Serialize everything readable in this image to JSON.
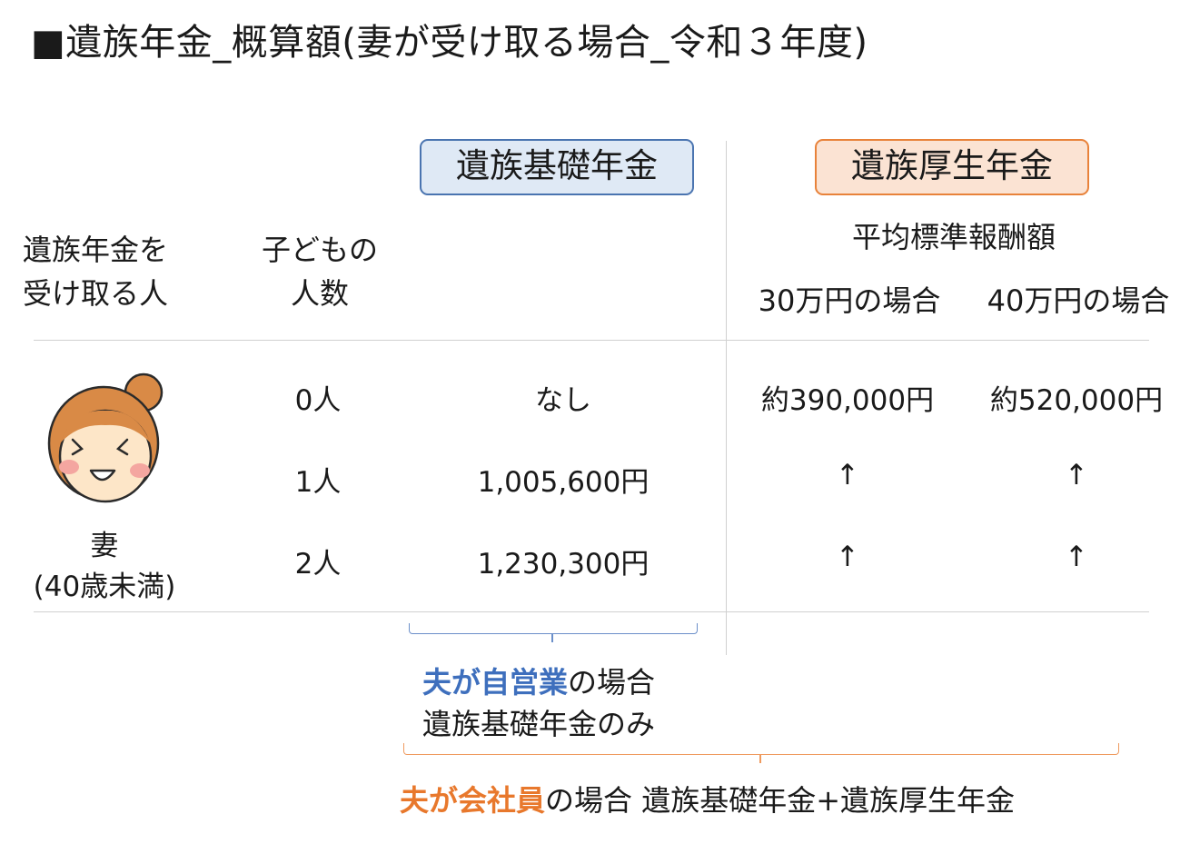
{
  "title": "■遺族年金_概算額(妻が受け取る場合_令和３年度)",
  "box_kiso": "遺族基礎年金",
  "box_kousei": "遺族厚生年金",
  "headers": {
    "recipient_line1": "遺族年金を",
    "recipient_line2": "受け取る人",
    "children_line1": "子どもの",
    "children_line2": "人数",
    "avg_pay": "平均標準報酬額",
    "case_30": "30万円の場合",
    "case_40": "40万円の場合"
  },
  "recipient": {
    "name": "妻",
    "age": "(40歳未満)",
    "icon": "smiling-woman-icon"
  },
  "rows": [
    {
      "children": "0人",
      "kiso": "なし",
      "k30": "約390,000円",
      "k40": "約520,000円"
    },
    {
      "children": "1人",
      "kiso": "1,005,600円",
      "k30": "↑",
      "k40": "↑"
    },
    {
      "children": "2人",
      "kiso": "1,230,300円",
      "k30": "↑",
      "k40": "↑"
    }
  ],
  "note_self": {
    "emph": "夫が自営業",
    "rest": "の場合",
    "line2": "遺族基礎年金のみ"
  },
  "note_company": {
    "emph": "夫が会社員",
    "rest": "の場合 遺族基礎年金+遺族厚生年金"
  },
  "colors": {
    "blue": "#3e6fbd",
    "orange": "#e8782c",
    "box_blue_bg": "#dfe9f5",
    "box_orange_bg": "#fbe3d3"
  }
}
